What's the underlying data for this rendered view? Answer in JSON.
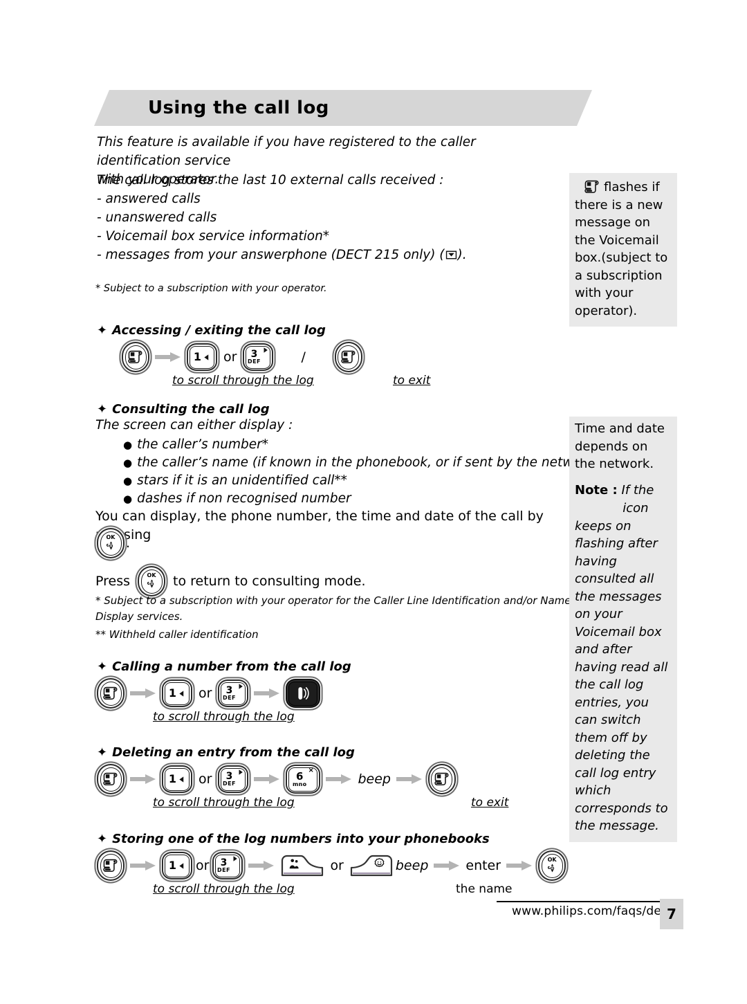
{
  "header": {
    "title": "Using the call log"
  },
  "intro": {
    "line1": "This feature is available if you have registered to the caller identification service",
    "line2": "with your operator."
  },
  "stores": {
    "lead": "The call log stores the last 10 external calls received :",
    "items": [
      "- answered calls",
      "- unanswered calls",
      "- Voicemail box service information*",
      "- messages from your answerphone (DECT 215 only) ("
    ],
    "item4_tail": ")."
  },
  "subnote": "* Subject to a subscription with your operator.",
  "sections": {
    "accessing": {
      "diamond": "✦",
      "title": "Accessing / exiting the call log",
      "or": "or",
      "slash": "/",
      "caption_scroll": "to scroll through the log",
      "caption_exit": "to exit"
    },
    "consulting": {
      "diamond": "✦",
      "title": "Consulting the call log",
      "lead": "The screen can either display :",
      "bullets": [
        "the caller’s number*",
        "the caller’s name (if known in the phonebook, or if sent by the network)*",
        "stars if it is an unidentified call**",
        "dashes if non recognised number"
      ],
      "para1": "You can display, the phone number, the time and date of the call by pressing",
      "para1_tail": ".",
      "press": "Press",
      "press_tail": "to return to consulting mode.",
      "footnote1_a": "* Subject to a subscription with your operator for the Caller Line Identification and/or Name",
      "footnote1_b": "Display services.",
      "footnote2": "** Withheld caller identification"
    },
    "calling": {
      "diamond": "✦",
      "title": "Calling a number from the call log",
      "or": "or",
      "caption_scroll": "to scroll through the log"
    },
    "deleting": {
      "diamond": "✦",
      "title": "Deleting an entry from the call log",
      "or": "or",
      "beep": "beep",
      "caption_scroll": "to scroll through the log",
      "caption_exit": "to exit"
    },
    "storing": {
      "diamond": "✦",
      "title": "Storing one of the log numbers into your phonebooks",
      "or1": "or",
      "or2": "or",
      "beep": "beep",
      "enter": "enter",
      "enter2": "the name",
      "caption_scroll": "to scroll through the log"
    }
  },
  "keys": {
    "calllog": {
      "icon": "call-log-scroll-icon",
      "label": ""
    },
    "key1": {
      "icon": "left-arrow-icon",
      "digit": "1",
      "letters": ""
    },
    "key3": {
      "icon": "right-arrow-icon",
      "digit": "3",
      "letters": "DEF"
    },
    "key6": {
      "icon": "delete-cross-icon",
      "digit": "6",
      "letters": "mno"
    },
    "ok": {
      "icon": "ok-navigation-icon",
      "label": "OK"
    },
    "call": {
      "icon": "phone-handset-icon"
    },
    "softkey_left": {
      "icon": "phonebook-people-icon"
    },
    "softkey_right": {
      "icon": "personal-phonebook-face-icon"
    },
    "envelope": {
      "icon": "answerphone-envelope-icon"
    }
  },
  "sidebar": {
    "box1": {
      "icon": "voicemail-scroll-icon",
      "text": "flashes if there is a new message on the Voicemail box.(subject to a subscription with your operator)."
    },
    "box2": {
      "text": "Time and date depends on the network."
    },
    "box3": {
      "label": "Note :",
      "text_before": "If the",
      "icon": "voicemail-scroll-icon",
      "icon_word": "icon",
      "text_after": "keeps on flashing after having consulted all the messages on your Voicemail box and after having read all the call log entries, you can switch them off by deleting the call log entry which corresponds to the message."
    }
  },
  "footer": {
    "url": "www.philips.com/faqs/dect",
    "page": "7"
  },
  "colors": {
    "banner_gray": "#d6d6d6",
    "sidebar_gray": "#e9e9e9",
    "arrow_gray": "#b3b3b3",
    "key_dark": "#2f2f2f"
  }
}
